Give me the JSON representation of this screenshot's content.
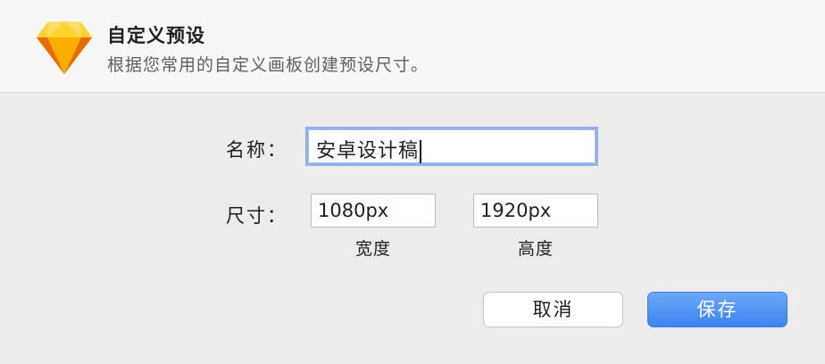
{
  "dialog": {
    "title": "自定义预设",
    "subtitle": "根据您常用的自定义画板创建预设尺寸。",
    "app_icon": "sketch-diamond-icon"
  },
  "form": {
    "name_label": "名称：",
    "name_value": "安卓设计稿",
    "size_label": "尺寸：",
    "width_value": "1080px",
    "width_label": "宽度",
    "height_value": "1920px",
    "height_label": "高度"
  },
  "buttons": {
    "cancel": "取消",
    "save": "保存"
  },
  "colors": {
    "accent": "#3d82f3",
    "focus_ring": "#8fb2ec",
    "icon_orange": "#f7a723"
  }
}
